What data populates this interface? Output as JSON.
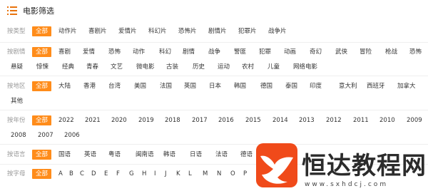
{
  "header": {
    "title": "电影筛选",
    "icon": "list-icon"
  },
  "filters": [
    {
      "key": "type",
      "label": "按类型",
      "active": "全部",
      "options": [
        "全部",
        "动作片",
        "喜剧片",
        "爱情片",
        "科幻片",
        "恐怖片",
        "剧情片",
        "犯罪片",
        "战争片"
      ]
    },
    {
      "key": "plot",
      "label": "按剧情",
      "active": "全部",
      "options": [
        "全部",
        "喜剧",
        "爱情",
        "恐怖",
        "动作",
        "科幻",
        "剧情",
        "战争",
        "警匪",
        "犯罪",
        "动画",
        "奇幻",
        "武侠",
        "冒险",
        "枪战",
        "恐怖",
        "悬疑",
        "惊悚",
        "经典",
        "青春",
        "文艺",
        "微电影",
        "古装",
        "历史",
        "运动",
        "农村",
        "儿童",
        "网络电影"
      ]
    },
    {
      "key": "region",
      "label": "按地区",
      "active": "全部",
      "options": [
        "全部",
        "大陆",
        "香港",
        "台湾",
        "美国",
        "法国",
        "英国",
        "日本",
        "韩国",
        "德国",
        "泰国",
        "印度",
        "意大利",
        "西班牙",
        "加拿大",
        "其他"
      ]
    },
    {
      "key": "year",
      "label": "按年份",
      "active": "全部",
      "options": [
        "全部",
        "2022",
        "2021",
        "2020",
        "2019",
        "2018",
        "2017",
        "2016",
        "2015",
        "2014",
        "2013",
        "2012",
        "2011",
        "2010",
        "2009",
        "2008",
        "2007",
        "2006"
      ]
    },
    {
      "key": "language",
      "label": "按语言",
      "active": "全部",
      "options": [
        "全部",
        "国语",
        "英语",
        "粤语",
        "闽南语",
        "韩语",
        "日语",
        "法语",
        "德语"
      ]
    },
    {
      "key": "letter",
      "label": "按字母",
      "active": "全部",
      "options": [
        "全部",
        "A",
        "B",
        "C",
        "D",
        "E",
        "F",
        "G",
        "H",
        "I",
        "J",
        "K",
        "L",
        "M",
        "N",
        "O",
        "P"
      ]
    }
  ],
  "watermark": {
    "text": "恒达教程网",
    "url": "www.sxhdcj.com"
  },
  "colors": {
    "accent": "#ff8c1a",
    "label": "#999999",
    "text": "#333333"
  }
}
